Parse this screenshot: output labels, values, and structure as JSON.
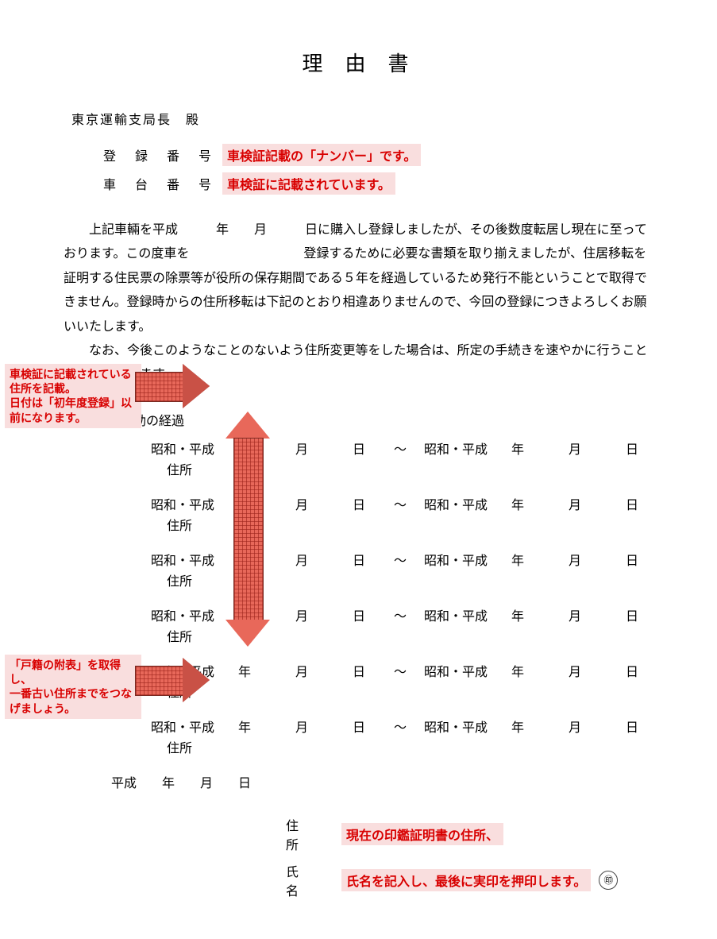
{
  "title": "理由書",
  "addressee": "東京運輸支局長　殿",
  "reg": {
    "label_reg": "登 録 番 号",
    "note_reg": "車検証記載の「ナンバー」です。",
    "label_chassis": "車 台 番 号",
    "note_chassis": "車検証に記載されています。"
  },
  "body": {
    "p1": "　上記車輛を平成　　　年　　月　　　日に購入し登録しましたが、その後数度転居し現在に至っております。この度車を　　　　　　　　　登録するために必要な書類を取り揃えましたが、住居移転を証明する住民票の除票等が役所の保存期間である５年を経過しているため発行不能ということで取得できません。登録時からの住所移転は下記のとおり相違ありませんので、今回の登録につきよろしくお願いいたします。",
    "p2": "　なお、今後このようなことのないよう住所変更等をした場合は、所定の手続きを速やかに行うことを約束いたします。"
  },
  "history_head": "住所移動の経過",
  "era_pair": "昭和・平成",
  "labels": {
    "year": "年",
    "month": "月",
    "day": "日",
    "tilde": "〜",
    "address": "住所"
  },
  "date_line": "平成　　年　　月　　日",
  "sig": {
    "addr_label": "住　所",
    "name_label": "氏　名",
    "addr_note": "現在の印鑑証明書の住所、",
    "name_note": "氏名を記入し、最後に実印を押印します。",
    "seal": "㊞"
  },
  "annotations": {
    "note1": "車検証に記載されている住所を記載。\n日付は「初年度登録」以前になります。",
    "note2": "「戸籍の附表」を取得し、\n一番古い住所までをつなげましょう。"
  }
}
